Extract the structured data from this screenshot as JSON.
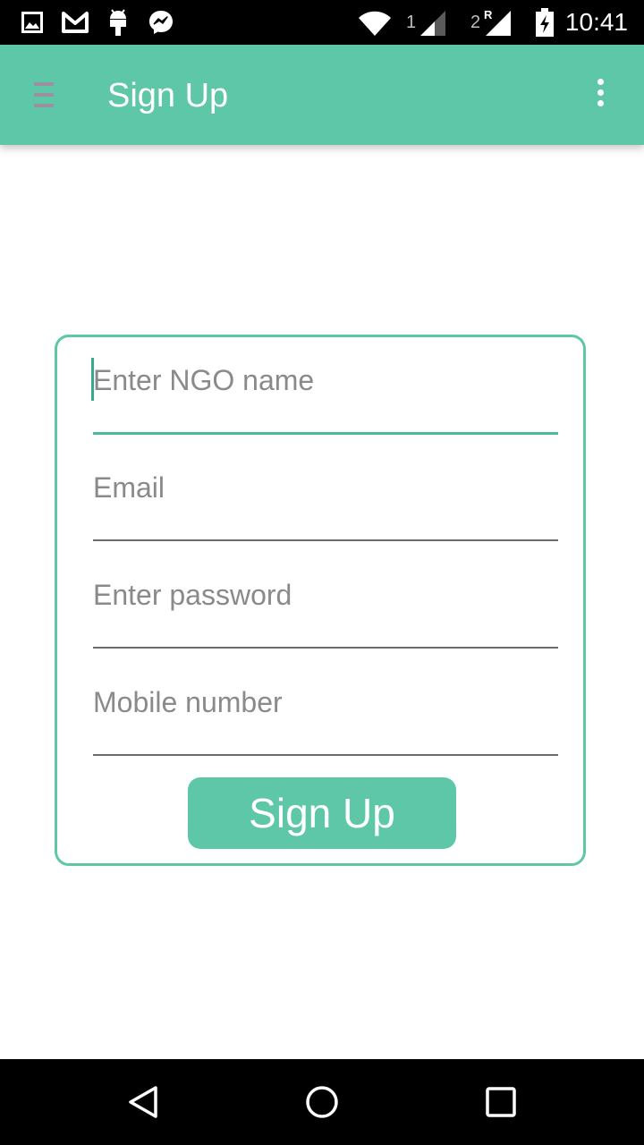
{
  "status_bar": {
    "time": "10:41",
    "sim1_label": "1",
    "sim2_label": "2",
    "sim2_roaming": "R",
    "icons": [
      "image-icon",
      "gmail-icon",
      "android-icon",
      "messenger-icon",
      "wifi-icon",
      "signal-icon",
      "signal-roaming-icon",
      "battery-charging-icon"
    ]
  },
  "app_bar": {
    "title": "Sign Up",
    "menu_icon": "hamburger-menu-icon",
    "overflow_icon": "more-vert-icon",
    "background": "#5dc7a7"
  },
  "form": {
    "ngo_name_placeholder": "Enter NGO name",
    "email_placeholder": "Email",
    "password_placeholder": "Enter password",
    "mobile_placeholder": "Mobile number",
    "ngo_name_value": "",
    "email_value": "",
    "password_value": "",
    "mobile_value": "",
    "submit_label": "Sign Up",
    "accent": "#5dc7a7"
  },
  "nav_bar": {
    "icons": [
      "back-icon",
      "home-icon",
      "recents-icon"
    ]
  }
}
